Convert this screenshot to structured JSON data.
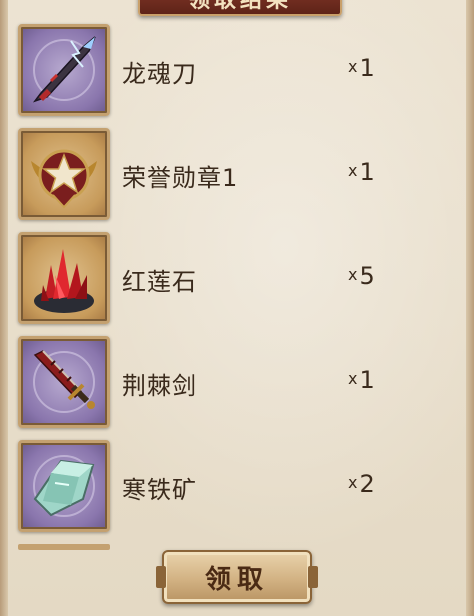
{
  "dialog": {
    "title": "领取结果",
    "button_label": "领取"
  },
  "items": [
    {
      "name": "龙魂刀",
      "qty_prefix": "x",
      "qty": "1",
      "icon": "dragon-soul-blade-icon",
      "frame": "purple"
    },
    {
      "name": "荣誉勋章1",
      "qty_prefix": "x",
      "qty": "1",
      "icon": "honor-medal-icon",
      "frame": "orange"
    },
    {
      "name": "红莲石",
      "qty_prefix": "x",
      "qty": "5",
      "icon": "red-lotus-stone-icon",
      "frame": "orange"
    },
    {
      "name": "荆棘剑",
      "qty_prefix": "x",
      "qty": "1",
      "icon": "thorn-sword-icon",
      "frame": "purple"
    },
    {
      "name": "寒铁矿",
      "qty_prefix": "x",
      "qty": "2",
      "icon": "cold-iron-ore-icon",
      "frame": "purple"
    }
  ],
  "colors": {
    "purple_frame": "#8a76ad",
    "orange_frame": "#c79b5b",
    "title_banner": "#8a3b2c",
    "text": "#3a2a1c"
  }
}
